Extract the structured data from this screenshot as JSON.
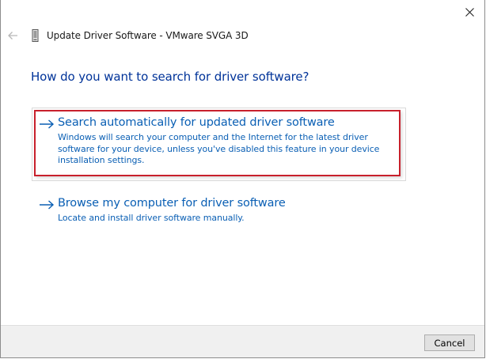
{
  "window": {
    "title": "Update Driver Software - VMware SVGA 3D"
  },
  "titlebar": {
    "close_icon": "close-icon",
    "back_icon": "back-arrow-icon",
    "device_icon": "device-icon"
  },
  "main": {
    "heading": "How do you want to search for driver software?",
    "options": [
      {
        "title": "Search automatically for updated driver software",
        "description": "Windows will search your computer and the Internet for the latest driver software for your device, unless you've disabled this feature in your device installation settings.",
        "icon": "arrow-right-icon",
        "highlighted": true
      },
      {
        "title": "Browse my computer for driver software",
        "description": "Locate and install driver software manually.",
        "icon": "arrow-right-icon",
        "highlighted": false
      }
    ]
  },
  "footer": {
    "cancel_label": "Cancel"
  },
  "colors": {
    "link": "#0a5fb4",
    "heading": "#003399",
    "highlight_border": "#c8202c",
    "footer_bg": "#f0f0f0"
  }
}
